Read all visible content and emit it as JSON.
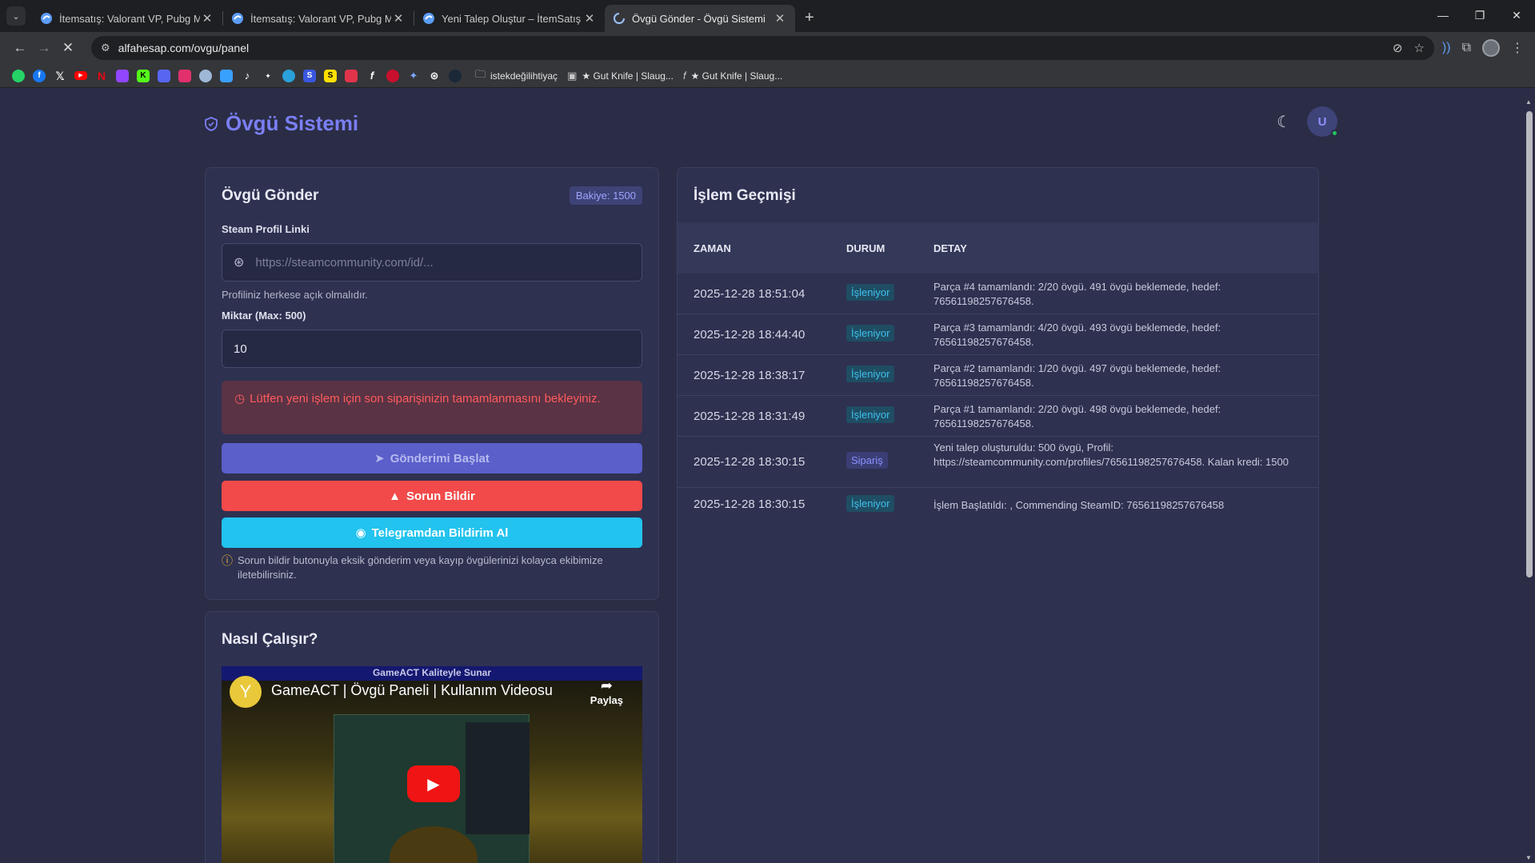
{
  "browser": {
    "tabs": [
      {
        "title": "İtemsatış: Valorant VP, Pubg Mobile",
        "active": false
      },
      {
        "title": "İtemsatış: Valorant VP, Pubg Mobile",
        "active": false
      },
      {
        "title": "Yeni Talep Oluştur – İtemSatış Destek",
        "active": false
      },
      {
        "title": "Övgü Gönder - Övgü Sistemi",
        "active": true
      }
    ],
    "url": "alfahesap.com/ovgu/panel",
    "bookmarks": [
      {
        "label": "istekdeğilihtiyaç"
      },
      {
        "label": "★ Gut Knife | Slaug..."
      },
      {
        "label": "★ Gut Knife | Slaug..."
      }
    ],
    "bookmark_icons": [
      "whatsapp-icon",
      "facebook-icon",
      "x-icon",
      "youtube-icon",
      "netflix-icon",
      "twitch-icon",
      "kick-icon",
      "discord-icon",
      "instagram-icon",
      "onedrive-icon",
      "files-icon",
      "tiktok-icon",
      "ai-icon",
      "telegram-icon",
      "s-icon",
      "sahibinden-icon",
      "reddit-icon",
      "f-icon",
      "pinterest-icon",
      "gemini-icon",
      "chatgpt-icon",
      "steam-icon"
    ]
  },
  "app": {
    "brand": "Övgü Sistemi",
    "user_initial": "U"
  },
  "send_form": {
    "title": "Övgü Gönder",
    "balance": "Bakiye: 1500",
    "steam_label": "Steam Profil Linki",
    "steam_placeholder": "https://steamcommunity.com/id/...",
    "steam_help": "Profiliniz herkese açık olmalıdır.",
    "amount_label": "Miktar (Max: 500)",
    "amount_value": "10",
    "alert": "Lütfen yeni işlem için son siparişinizin tamamlanmasını bekleyiniz.",
    "send_button": "Gönderimi Başlat",
    "report_button": "Sorun Bildir",
    "telegram_button": "Telegramdan Bildirim Al",
    "note": "Sorun bildir butonuyla eksik gönderim veya kayıp övgülerinizi kolayca ekibimize iletebilirsiniz."
  },
  "how": {
    "title": "Nasıl Çalışır?",
    "video_banner": "GameACT Kaliteyle Sunar",
    "video_title": "GameACT | Övgü Paneli | Kullanım Videosu",
    "share_label": "Paylaş"
  },
  "history": {
    "title": "İşlem Geçmişi",
    "columns": {
      "time": "ZAMAN",
      "status": "DURUM",
      "detail": "DETAY"
    },
    "rows": [
      {
        "time": "2025-12-28 18:51:04",
        "status": "İşleniyor",
        "detail": "Parça #4 tamamlandı: 2/20 övgü. 491 övgü beklemede, hedef: 76561198257676458."
      },
      {
        "time": "2025-12-28 18:44:40",
        "status": "İşleniyor",
        "detail": "Parça #3 tamamlandı: 4/20 övgü. 493 övgü beklemede, hedef: 76561198257676458."
      },
      {
        "time": "2025-12-28 18:38:17",
        "status": "İşleniyor",
        "detail": "Parça #2 tamamlandı: 1/20 övgü. 497 övgü beklemede, hedef: 76561198257676458."
      },
      {
        "time": "2025-12-28 18:31:49",
        "status": "İşleniyor",
        "detail": "Parça #1 tamamlandı: 2/20 övgü. 498 övgü beklemede, hedef: 76561198257676458."
      },
      {
        "time": "2025-12-28 18:30:15",
        "status": "Sipariş",
        "detail": "Yeni talep oluşturuldu: 500 övgü, Profil: https://steamcommunity.com/profiles/76561198257676458. Kalan kredi: 1500"
      },
      {
        "time": "2025-12-28 18:30:15",
        "status": "İşleniyor",
        "detail": "İşlem Başlatıldı: , Commending SteamID: 76561198257676458"
      }
    ]
  }
}
